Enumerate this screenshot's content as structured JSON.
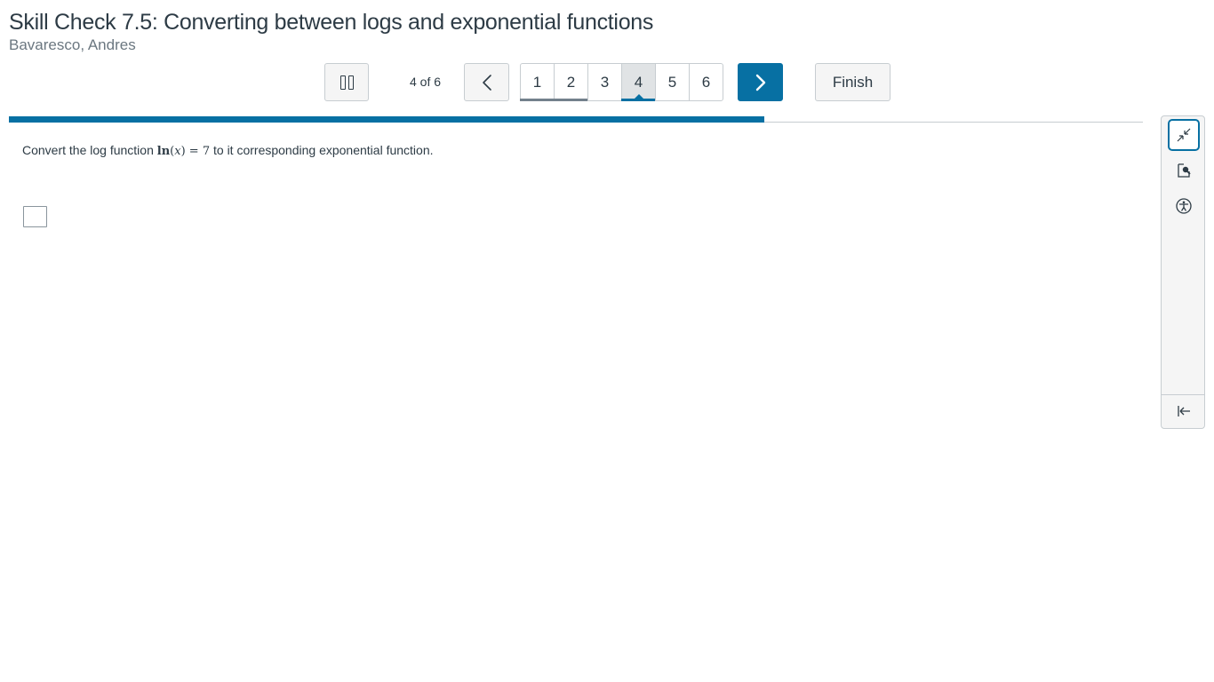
{
  "quiz": {
    "title": "Skill Check 7.5: Converting between logs and exponential functions",
    "student": "Bavaresco, Andres"
  },
  "toolbar": {
    "pause_icon": "pause-icon",
    "counter": "4 of 6",
    "prev_icon": "chevron-left-icon",
    "next_icon": "chevron-right-icon",
    "finish_label": "Finish",
    "pages": [
      {
        "label": "1",
        "state": "visited"
      },
      {
        "label": "2",
        "state": "visited"
      },
      {
        "label": "3",
        "state": "unvisited"
      },
      {
        "label": "4",
        "state": "current"
      },
      {
        "label": "5",
        "state": "unvisited"
      },
      {
        "label": "6",
        "state": "unvisited"
      }
    ]
  },
  "progress": {
    "fraction": 0.666,
    "color": "#0770a3"
  },
  "question": {
    "prefix": "Convert the log function ",
    "math_fn": "ln",
    "math_open": "(",
    "math_var": "x",
    "math_close": ")",
    "math_eq": " = ",
    "math_val": "7",
    "suffix": " to it corresponding exponential function.",
    "answer_value": ""
  },
  "side_tools": {
    "collapse_icon": "collapse-arrows-icon",
    "preview_icon": "document-search-icon",
    "accessibility_icon": "accessibility-icon",
    "expand_panel_icon": "arrow-left-to-bar-icon"
  },
  "colors": {
    "accent": "#0770a3",
    "text": "#2d3b45",
    "muted": "#6b7780",
    "border": "#c7cdd1"
  }
}
